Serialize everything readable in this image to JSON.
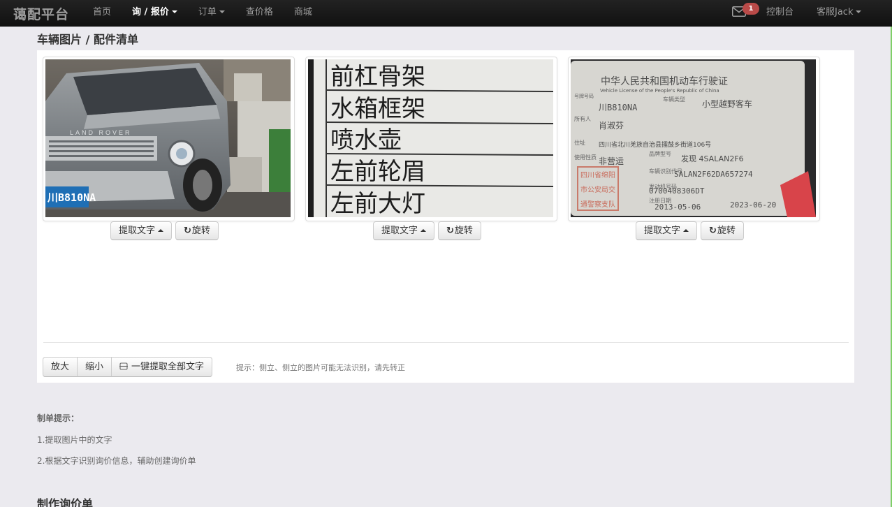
{
  "navbar": {
    "brand": "蔼配平台",
    "items": [
      {
        "label": "首页",
        "active": false,
        "dropdown": false
      },
      {
        "label": "询 / 报价",
        "active": true,
        "dropdown": true
      },
      {
        "label": "订单",
        "active": false,
        "dropdown": true
      },
      {
        "label": "查价格",
        "active": false,
        "dropdown": false
      },
      {
        "label": "商城",
        "active": false,
        "dropdown": false
      }
    ],
    "mail_badge": "1",
    "console": "控制台",
    "user": "客服Jack"
  },
  "section": {
    "title": "车辆图片 / 配件清单"
  },
  "images": [
    {
      "kind": "car-photo",
      "plate": "川B810NA",
      "extract_label": "提取文字",
      "rotate_label": "旋转"
    },
    {
      "kind": "parts-list",
      "lines": [
        "前杠骨架",
        "水箱框架",
        "喷水壶",
        "左前轮眉",
        "左前大灯"
      ],
      "extract_label": "提取文字",
      "rotate_label": "旋转"
    },
    {
      "kind": "vehicle-license",
      "title": "中华人民共和国机动车行驶证",
      "subtitle": "Vehicle License of the People's Republic of China",
      "plate": "川B810NA",
      "vehicle_type": "小型越野客车",
      "owner": "肖淑芬",
      "address": "四川省北川羌族自治县擂鼓乡街道106号",
      "use": "非营运",
      "model": "发现 4SALAN2F6",
      "vin": "SALAN2F62DA657274",
      "engine": "0700408306DT",
      "register_date": "2013-05-06",
      "issue_date": "2023-06-20",
      "stamp": "四川省绵阳市公安局交通警察支队",
      "extract_label": "提取文字",
      "rotate_label": "旋转"
    }
  ],
  "toolbar": {
    "zoom_in": "放大",
    "zoom_out": "缩小",
    "extract_all": "一键提取全部文字",
    "hint": "提示：侧立、侧立的图片可能无法识别，请先转正"
  },
  "tips": {
    "title": "制单提示：",
    "items": [
      "1.提取图片中的文字",
      "2.根据文字识别询价信息，辅助创建询价单"
    ]
  },
  "bottom": {
    "title": "制作询价单"
  }
}
